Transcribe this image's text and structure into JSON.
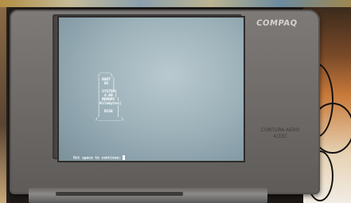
{
  "device": {
    "brand_logo": "COMPAQ",
    "model_label": "CONTURA AERO 4/33C"
  },
  "screen": {
    "ascii_art": "  _____\n /     \\\n | BOOT |\n |  OS  |\n |      |\n | SYSTEM|\n |  4.00 |\n | MEMORY |\n |Kilobytes|\n |        |\n |  DISK  |\n |        |\n/___________\\",
    "prompt_text": "Hit space to continue:"
  },
  "colors": {
    "screen_bg": "#9fb3bb",
    "screen_text": "#fafcfd",
    "bezel": "#6e6b69"
  }
}
